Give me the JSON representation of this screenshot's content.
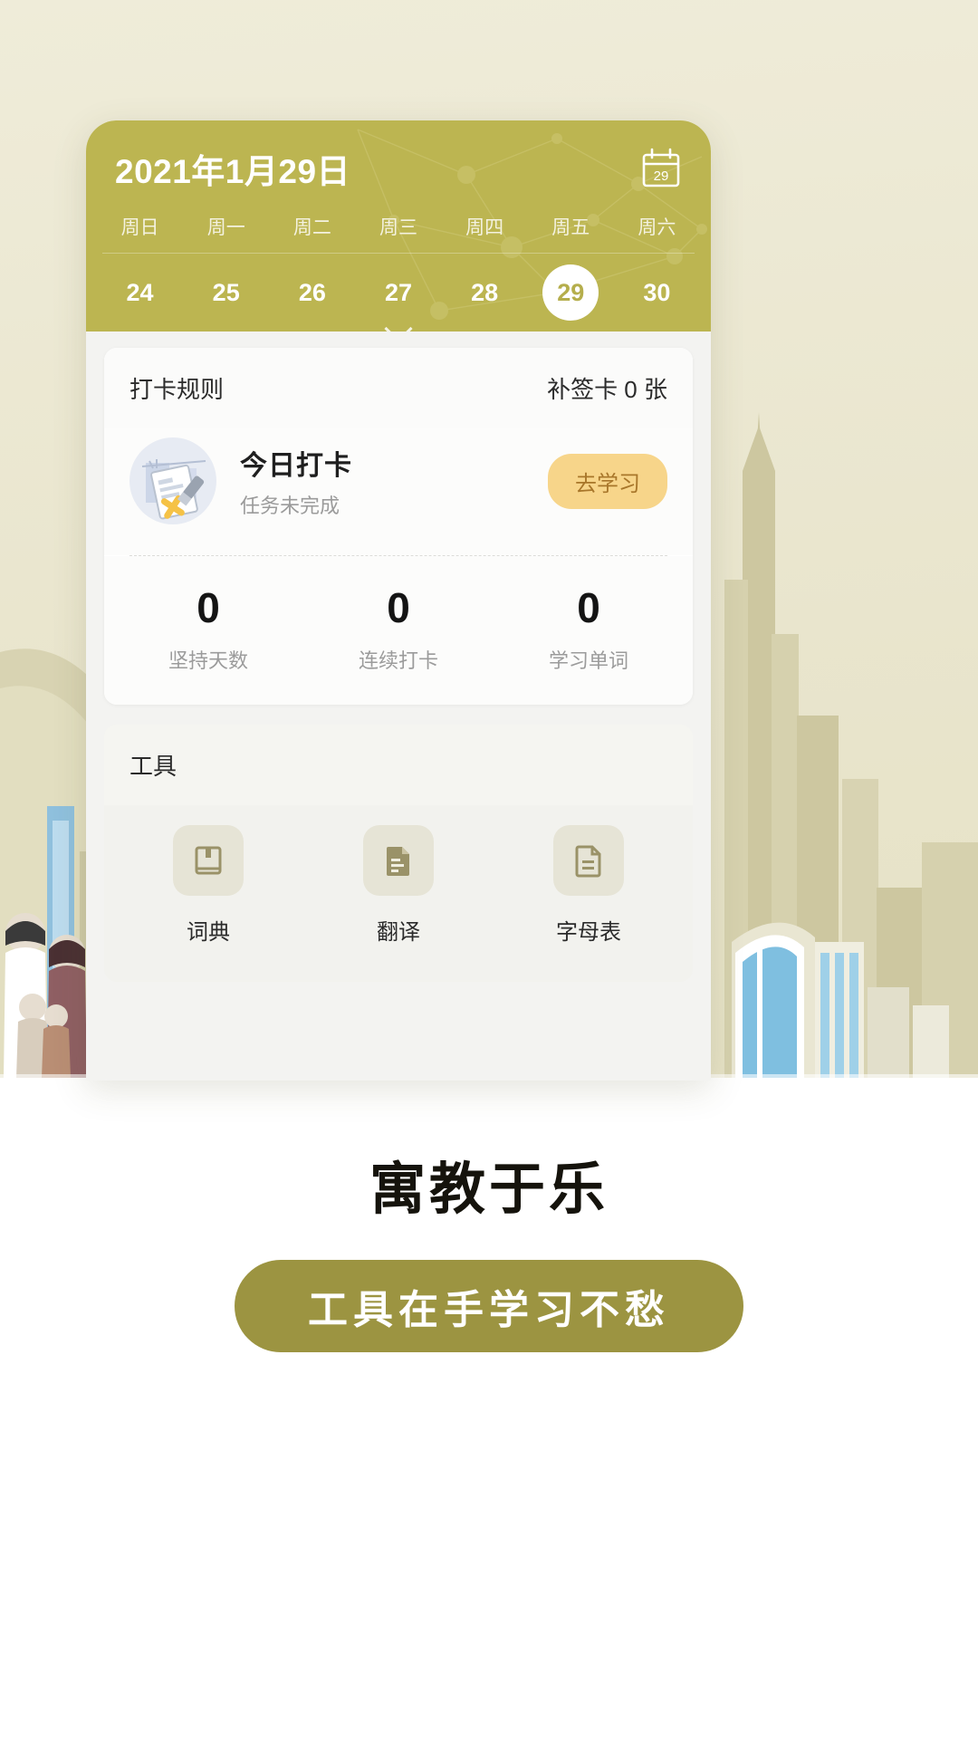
{
  "app": {
    "header": {
      "date_title": "2021年1月29日",
      "calendar_icon": "calendar-29-icon",
      "calendar_icon_day": "29",
      "weekdays": [
        "周日",
        "周一",
        "周二",
        "周三",
        "周四",
        "周五",
        "周六"
      ],
      "dates": [
        "24",
        "25",
        "26",
        "27",
        "28",
        "29",
        "30"
      ],
      "selected_date": "29",
      "expand_icon": "chevron-down-icon",
      "bg_color": "#bcb551"
    },
    "checkin_card": {
      "rules_label": "打卡规则",
      "makeup_label": "补签卡 0 张",
      "task": {
        "illustration_icon": "checklist-cross-icon",
        "title": "今日打卡",
        "subtitle": "任务未完成",
        "button_label": "去学习",
        "button_color": "#f7d58a",
        "button_text_color": "#a8762a"
      },
      "stats": [
        {
          "value": "0",
          "label": "坚持天数"
        },
        {
          "value": "0",
          "label": "连续打卡"
        },
        {
          "value": "0",
          "label": "学习单词"
        }
      ]
    },
    "tools_card": {
      "title": "工具",
      "items": [
        {
          "icon": "book-icon",
          "label": "词典"
        },
        {
          "icon": "translate-doc-icon",
          "label": "翻译"
        },
        {
          "icon": "document-lines-icon",
          "label": "字母表"
        }
      ]
    }
  },
  "promo": {
    "tagline": "寓教于乐",
    "cta_label": "工具在手学习不愁",
    "cta_color": "#9c9441"
  }
}
